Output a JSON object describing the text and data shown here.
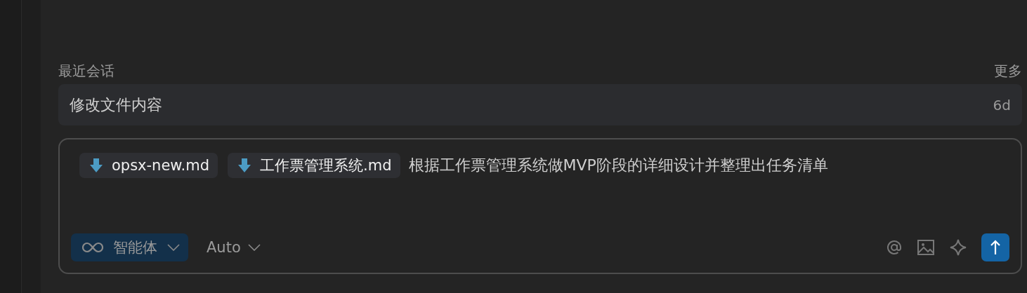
{
  "recent": {
    "title": "最近会话",
    "more": "更多",
    "items": [
      {
        "title": "修改文件内容",
        "age": "6d"
      }
    ]
  },
  "composer": {
    "attachments": [
      {
        "name": "opsx-new.md"
      },
      {
        "name": "工作票管理系统.md"
      }
    ],
    "text": "根据工作票管理系统做MVP阶段的详细设计并整理出任务清单",
    "mode": {
      "label": "智能体"
    },
    "model": {
      "label": "Auto"
    }
  }
}
